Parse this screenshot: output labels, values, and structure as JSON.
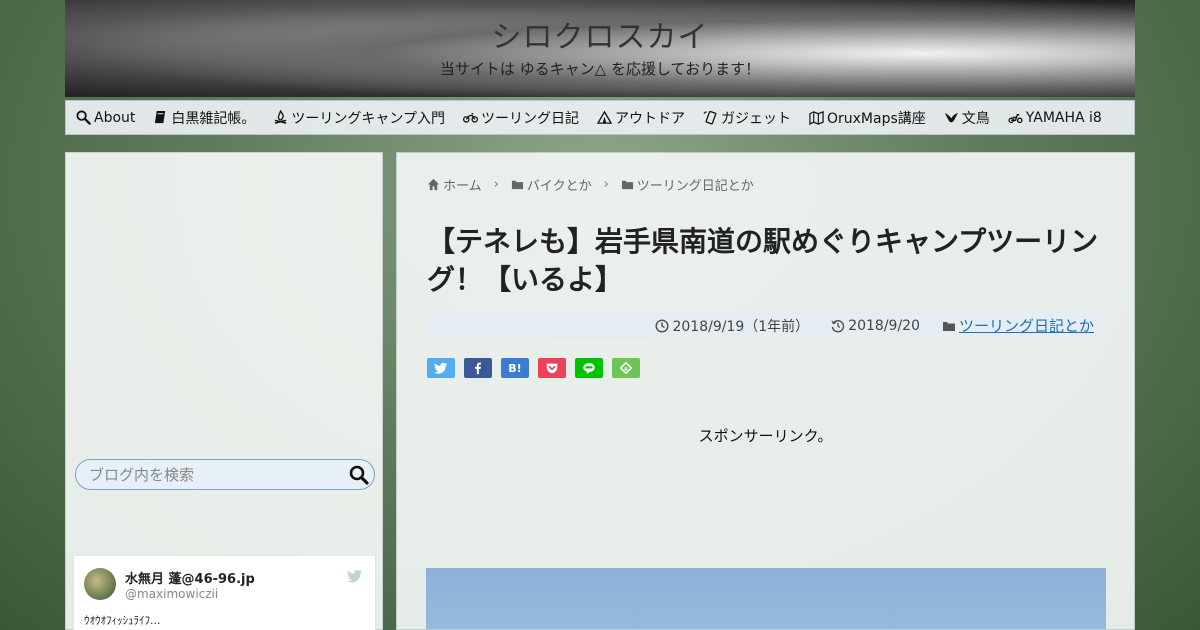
{
  "header": {
    "title": "シロクロスカイ",
    "tagline": "当サイトは ゆるキャン△ を応援しております！"
  },
  "nav": {
    "items": [
      {
        "label": "About",
        "icon": "search-icon"
      },
      {
        "label": "白黒雑記帳。",
        "icon": "book-icon"
      },
      {
        "label": "ツーリングキャンプ入門",
        "icon": "campfire-icon"
      },
      {
        "label": "ツーリング日記",
        "icon": "motorcycle-icon"
      },
      {
        "label": "アウトドア",
        "icon": "tent-icon"
      },
      {
        "label": "ガジェット",
        "icon": "phone-icon"
      },
      {
        "label": "OruxMaps講座",
        "icon": "map-icon"
      },
      {
        "label": "文鳥",
        "icon": "bird-icon"
      },
      {
        "label": "YAMAHA i8",
        "icon": "scooter-icon"
      }
    ]
  },
  "sidebar": {
    "search": {
      "placeholder": "ブログ内を検索"
    },
    "tweet": {
      "name": "水無月 蓬@46-96.jp",
      "handle": "@maximowiczii",
      "text": "ｳｵｳｵﾌｨｯｼｭﾗｲﾌ..."
    }
  },
  "main": {
    "breadcrumb": {
      "home": "ホーム",
      "cat1": "バイクとか",
      "cat2": "ツーリング日記とか"
    },
    "title": "【テネレも】岩手県南道の駅めぐりキャンプツーリング！【いるよ】",
    "meta": {
      "published": "2018/9/19（1年前）",
      "updated": "2018/9/20",
      "category": "ツーリング日記とか"
    },
    "share": {
      "hatena_label": "B!"
    },
    "sponsor_text": "スポンサーリンク。"
  },
  "colors": {
    "twitter": "#55acee",
    "facebook": "#3b5998",
    "hatena": "#3c7dd1",
    "pocket": "#ee4056",
    "line": "#00c300",
    "feedly": "#6cc655",
    "link": "#1f6fb2"
  }
}
